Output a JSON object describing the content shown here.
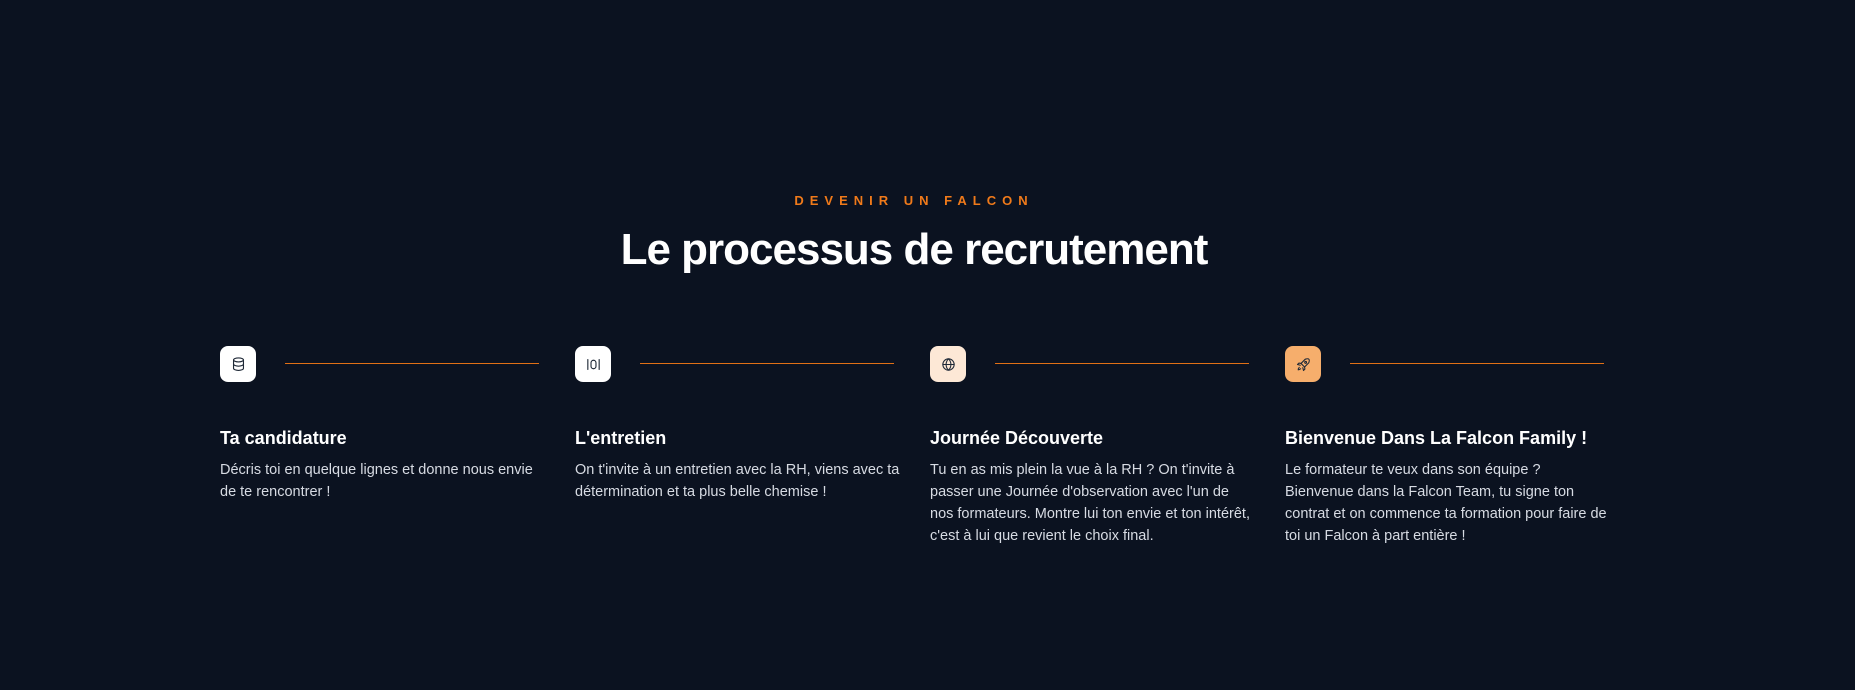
{
  "section": {
    "eyebrow": "DEVENIR UN FALCON",
    "title": "Le processus de recrutement"
  },
  "colors": {
    "background": "#0b1220",
    "accent": "#f07a1a",
    "connector": "#e07016"
  },
  "steps": [
    {
      "icon": "database-icon",
      "icon_bg": "#ffffff",
      "title": "Ta candidature",
      "text": "Décris toi en quelque lignes et donne nous envie de te rencontrer !"
    },
    {
      "icon": "brackets-icon",
      "icon_bg": "#ffffff",
      "title": "L'entretien",
      "text": "On t'invite à un entretien avec la RH, viens avec ta détermination et ta plus belle chemise !"
    },
    {
      "icon": "globe-icon",
      "icon_bg": "#fde8d6",
      "title": "Journée Découverte",
      "text": "Tu en as mis plein la vue à la RH ? On t'invite à passer une Journée d'observation avec l'un de nos formateurs. Montre lui ton envie et ton intérêt, c'est à lui que revient le choix final."
    },
    {
      "icon": "rocket-icon",
      "icon_bg": "#f6ae6c",
      "title": "Bienvenue Dans La Falcon Family !",
      "text": "Le formateur te veux dans son équipe ? Bienvenue dans la Falcon Team, tu signe ton contrat et on commence ta formation pour faire de toi un Falcon à part entière !"
    }
  ]
}
